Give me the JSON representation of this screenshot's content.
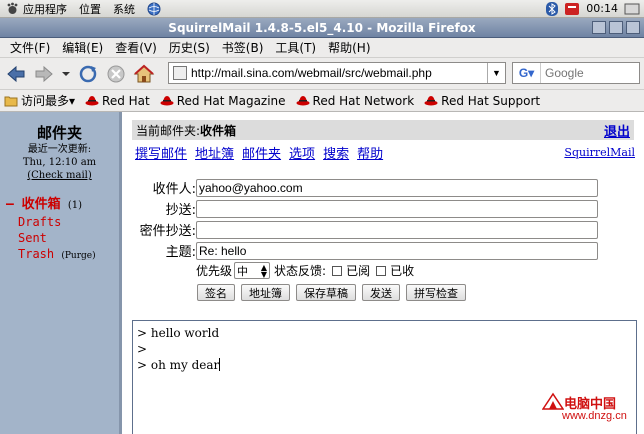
{
  "panel": {
    "applications": "应用程序",
    "places": "位置",
    "system": "系统",
    "clock": "00:14"
  },
  "window": {
    "title": "SquirrelMail 1.4.8-5.el5_4.10 - Mozilla Firefox"
  },
  "menubar": {
    "items": [
      "文件(F)",
      "编辑(E)",
      "查看(V)",
      "历史(S)",
      "书签(B)",
      "工具(T)",
      "帮助(H)"
    ]
  },
  "toolbar": {
    "url": "http://mail.sina.com/webmail/src/webmail.php",
    "search_placeholder": "Google"
  },
  "bookmarks": {
    "most_visited": "访问最多▾",
    "items": [
      "Red Hat",
      "Red Hat Magazine",
      "Red Hat Network",
      "Red Hat Support"
    ]
  },
  "sidebar": {
    "title": "邮件夹",
    "last_update_label": "最近一次更新:",
    "last_update_time": "Thu, 12:10 am",
    "check_mail": "(Check mail)",
    "inbox": "收件箱",
    "inbox_count": "(1)",
    "drafts": "Drafts",
    "sent": "Sent",
    "trash": "Trash",
    "purge": "(Purge)"
  },
  "main": {
    "current_folder_label": "当前邮件夹:",
    "current_folder": "收件箱",
    "logout": "退出",
    "nav": [
      "撰写邮件",
      "地址簿",
      "邮件夹",
      "选项",
      "搜索",
      "帮助"
    ],
    "brand_link": "SquirrelMail",
    "to_label": "收件人:",
    "to_value": "yahoo@yahoo.com",
    "cc_label": "抄送:",
    "cc_value": "",
    "bcc_label": "密件抄送:",
    "bcc_value": "",
    "subject_label": "主题:",
    "subject_value": "Re: hello",
    "priority_label": "优先级",
    "priority_value": "中",
    "receipt_label": "状态反馈:",
    "read_label": "已阅",
    "received_label": "已收",
    "buttons": [
      "签名",
      "地址簿",
      "保存草稿",
      "发送",
      "拼写检查"
    ],
    "body_lines": [
      "> hello world",
      ">",
      "> oh my dear"
    ]
  },
  "watermark": {
    "line1": "电脑中国",
    "line2": "www.dnzg.cn"
  },
  "colors": {
    "sidebar_bg": "#a3b4c9",
    "link": "#0000cc",
    "accent_red": "#cc0000"
  }
}
